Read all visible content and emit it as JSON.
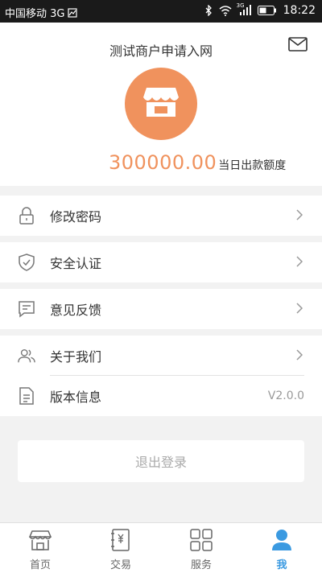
{
  "status_bar": {
    "carrier": "中国移动 3G",
    "time": "18:22",
    "network_label": "3G"
  },
  "header": {
    "title": "测试商户申请入网",
    "quota_amount": "300000.00",
    "quota_label": "当日出款额度"
  },
  "menu": [
    {
      "label": "修改密码",
      "icon": "lock-icon"
    },
    {
      "label": "安全认证",
      "icon": "shield-check-icon"
    },
    {
      "label": "意见反馈",
      "icon": "feedback-icon"
    },
    {
      "label": "关于我们",
      "icon": "users-icon"
    },
    {
      "label": "版本信息",
      "icon": "document-icon",
      "value": "V2.0.0"
    }
  ],
  "logout_label": "退出登录",
  "tabs": [
    {
      "label": "首页",
      "icon": "store-icon"
    },
    {
      "label": "交易",
      "icon": "yen-book-icon"
    },
    {
      "label": "服务",
      "icon": "grid-icon"
    },
    {
      "label": "我",
      "icon": "person-icon",
      "active": true
    }
  ],
  "colors": {
    "accent_orange": "#f0925d",
    "active_blue": "#3b9ae1",
    "status_bar_bg": "#1a1a1a"
  }
}
